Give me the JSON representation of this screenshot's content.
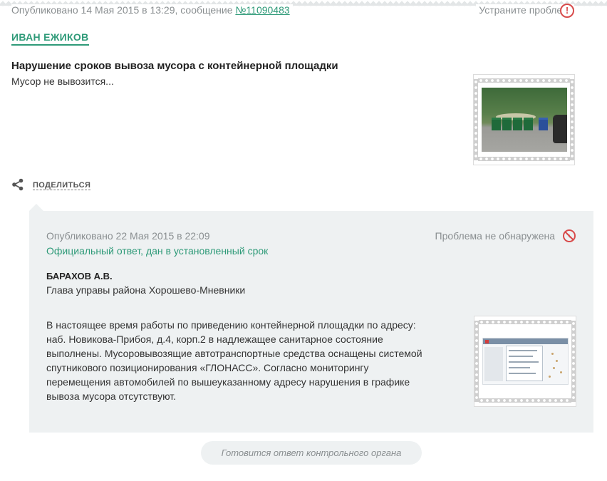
{
  "header": {
    "published_prefix": "Опубликовано 14 Мая 2015 в 13:29, сообщение ",
    "message_number": "№11090483",
    "fix_link": "Устраните проблему",
    "fix_icon": "exclamation-icon"
  },
  "complaint": {
    "author": "ИВАН ЕЖИКОВ",
    "title": "Нарушение сроков вывоза мусора с контейнерной площадки",
    "text": "Мусор не вывозится...",
    "photo": "photo-of-trash-containers"
  },
  "share": {
    "label": "ПОДЕЛИТЬСЯ",
    "icon": "share-icon"
  },
  "answer": {
    "published": "Опубликовано 22 Мая 2015 в 22:09",
    "status": "Официальный ответ, дан в установленный срок",
    "problem_status": "Проблема не обнаружена",
    "problem_icon": "not-found-icon",
    "official_name": "БАРАХОВ А.В.",
    "official_role": "Глава управы района Хорошево-Мневники",
    "text_lines": [
      "В настоящее время работы по приведению контейнерной площадки по адресу:",
      "наб. Новикова-Прибоя, д.4, корп.2 в надлежащее санитарное состояние",
      "выполнены. Мусоровывозящие автотранспортные средства оснащены системой",
      "спутникового позиционирования «ГЛОНАСС». Согласно мониторингу",
      "перемещения автомобилей по вышеуказанному адресу нарушения в графике",
      "вывоза мусора отсутствуют."
    ],
    "photo": "screenshot-of-gps-monitoring-system"
  },
  "pending": {
    "label": "Готовится ответ контрольного органа"
  },
  "colors": {
    "accent": "#2e9a78",
    "warning": "#d84b4b",
    "muted": "#8a8f91",
    "panel": "#eef1f2"
  }
}
